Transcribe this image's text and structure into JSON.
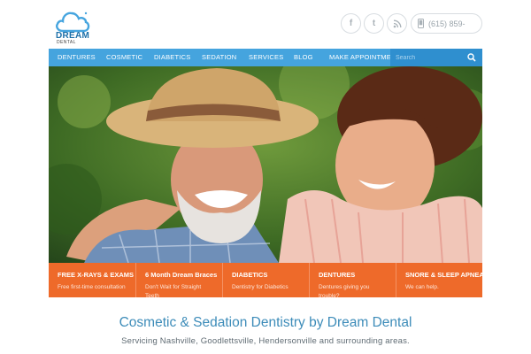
{
  "brand": {
    "name": "DREAM",
    "sub": "DENTAL",
    "colors": {
      "primary": "#45a4de",
      "accent": "#ee6a2a",
      "headline": "#3d8cb9"
    }
  },
  "social": [
    {
      "icon": "facebook-icon",
      "glyph": "f"
    },
    {
      "icon": "twitter-icon",
      "glyph": "t"
    },
    {
      "icon": "rss-icon",
      "glyph": "rss"
    }
  ],
  "phone": {
    "icon": "phone-icon",
    "text": "(615) 859-"
  },
  "nav": {
    "items": [
      "DENTURES",
      "COSMETIC",
      "DIABETICS",
      "SEDATION",
      "SERVICES",
      "BLOG",
      "MAKE APPOINTMENT"
    ],
    "search_placeholder": "Search",
    "search_icon": "search-icon"
  },
  "features": [
    {
      "title": "FREE X-RAYS & EXAMS",
      "sub": "Free first-time consultation"
    },
    {
      "title": "6 Month Dream Braces",
      "sub": "Don't Wait for Straight Teeth"
    },
    {
      "title": "DIABETICS",
      "sub": "Dentistry for Diabetics"
    },
    {
      "title": "DENTURES",
      "sub": "Dentures giving you trouble?"
    },
    {
      "title": "SNORE & SLEEP APNEA",
      "sub": "We can help."
    }
  ],
  "main": {
    "headline": "Cosmetic & Sedation Dentistry by Dream Dental",
    "subline": "Servicing Nashville, Goodlettsville, Hendersonville and surrounding areas."
  }
}
